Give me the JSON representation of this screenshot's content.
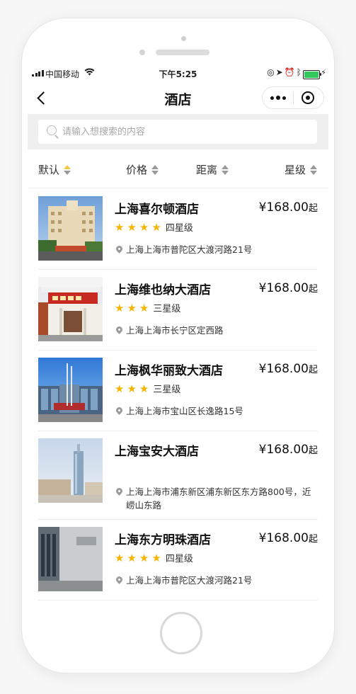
{
  "status_bar": {
    "carrier": "中国移动",
    "time": "下午5:25"
  },
  "nav": {
    "title": "酒店"
  },
  "search": {
    "placeholder": "请输入想搜索的内容"
  },
  "sort": [
    "默认",
    "价格",
    "距离",
    "星级"
  ],
  "hotels": [
    {
      "name": "上海喜尔顿酒店",
      "price": "¥168.00",
      "price_suffix": "起",
      "stars": 4,
      "level": "四星级",
      "address": "上海上海市普陀区大渡河路21号"
    },
    {
      "name": "上海维也纳大酒店",
      "price": "¥168.00",
      "price_suffix": "起",
      "stars": 3,
      "level": "三星级",
      "address": "上海上海市长宁区定西路"
    },
    {
      "name": "上海枫华丽致大酒店",
      "price": "¥168.00",
      "price_suffix": "起",
      "stars": 3,
      "level": "三星级",
      "address": "上海上海市宝山区长逸路15号"
    },
    {
      "name": "上海宝安大酒店",
      "price": "¥168.00",
      "price_suffix": "起",
      "stars": 0,
      "level": "",
      "address": "上海上海市浦东新区浦东新区东方路800号，近崂山东路"
    },
    {
      "name": "上海东方明珠酒店",
      "price": "¥168.00",
      "price_suffix": "起",
      "stars": 4,
      "level": "四星级",
      "address": "上海上海市普陀区大渡河路21号"
    }
  ],
  "colors": {
    "star": "#f5b400",
    "battery": "#34c759",
    "sort_active": "#f2c744"
  }
}
